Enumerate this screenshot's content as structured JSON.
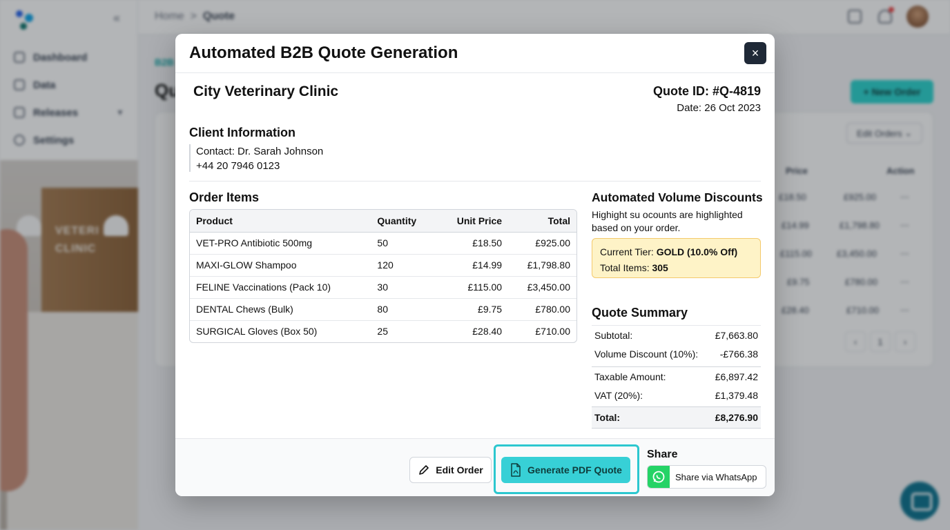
{
  "background": {
    "breadcrumb": {
      "home": "Home",
      "sep": ">",
      "current": "Quote"
    },
    "sidebar": [
      {
        "label": "Dashboard",
        "icon": "home-icon"
      },
      {
        "label": "Data",
        "icon": "document-icon"
      },
      {
        "label": "Releases",
        "icon": "box-icon"
      },
      {
        "label": "Settings",
        "icon": "gear-icon"
      }
    ],
    "page_label": "B2B",
    "page_heading": "Qu",
    "new_order_label": "New Order",
    "edit_orders_label": "Edit Orders",
    "columns": {
      "price": "Price",
      "action": "Action"
    },
    "rows": [
      {
        "price": "£18.50",
        "total": "£925.00"
      },
      {
        "price": "£14.99",
        "total": "£1,798.80"
      },
      {
        "price": "£115.00",
        "total": "£3,450.00"
      },
      {
        "price": "£9.75",
        "total": "£780.00"
      },
      {
        "price": "£28.40",
        "total": "£710.00"
      }
    ],
    "pager": [
      "‹",
      "1",
      "›"
    ],
    "photo_sign": [
      "VETERI",
      "CLINIC"
    ]
  },
  "modal": {
    "title": "Automated B2B Quote Generation",
    "close_icon": "×",
    "clinic_name": "City Veterinary Clinic",
    "quote_id": "Quote ID: #Q-4819",
    "date": "Date: 26 Oct 2023",
    "client_heading": "Client Information",
    "contact": "Contact: Dr. Sarah Johnson",
    "phone": "+44 20 7946 0123",
    "order_heading": "Order Items",
    "table": {
      "headers": [
        "Product",
        "Quantity",
        "Unit Price",
        "Total"
      ],
      "rows": [
        [
          "VET-PRO Antibiotic 500mg",
          "50",
          "£18.50",
          "£925.00"
        ],
        [
          "MAXI-GLOW Shampoo",
          "120",
          "£14.99",
          "£1,798.80"
        ],
        [
          "FELINE Vaccinations (Pack 10)",
          "30",
          "£115.00",
          "£3,450.00"
        ],
        [
          "DENTAL Chews (Bulk)",
          "80",
          "£9.75",
          "£780.00"
        ],
        [
          "SURGICAL Gloves (Box 50)",
          "25",
          "£28.40",
          "£710.00"
        ]
      ]
    },
    "discount_heading": "Automated Volume Discounts",
    "discount_text": "Highight su ocounts are highlighted based on your order.",
    "tier_label": "Current Tier:",
    "tier_value": "GOLD (10.0% Off)",
    "items_label": "Total Items:",
    "items_value": "305",
    "summary_heading": "Quote Summary",
    "summary": {
      "subtotal_label": "Subtotal:",
      "subtotal": "£7,663.80",
      "discount_label": "Volume Discount (10%):",
      "discount": "-£766.38",
      "taxable_label": "Taxable Amount:",
      "taxable": "£6,897.42",
      "vat_label": "VAT (20%):",
      "vat": "£1,379.48",
      "total_label": "Total:",
      "total": "£8,276.90"
    },
    "footer": {
      "edit_label": "Edit Order",
      "pdf_label": "Generate PDF Quote",
      "share_heading": "Share",
      "whatsapp_label": "Share via WhatsApp"
    }
  }
}
